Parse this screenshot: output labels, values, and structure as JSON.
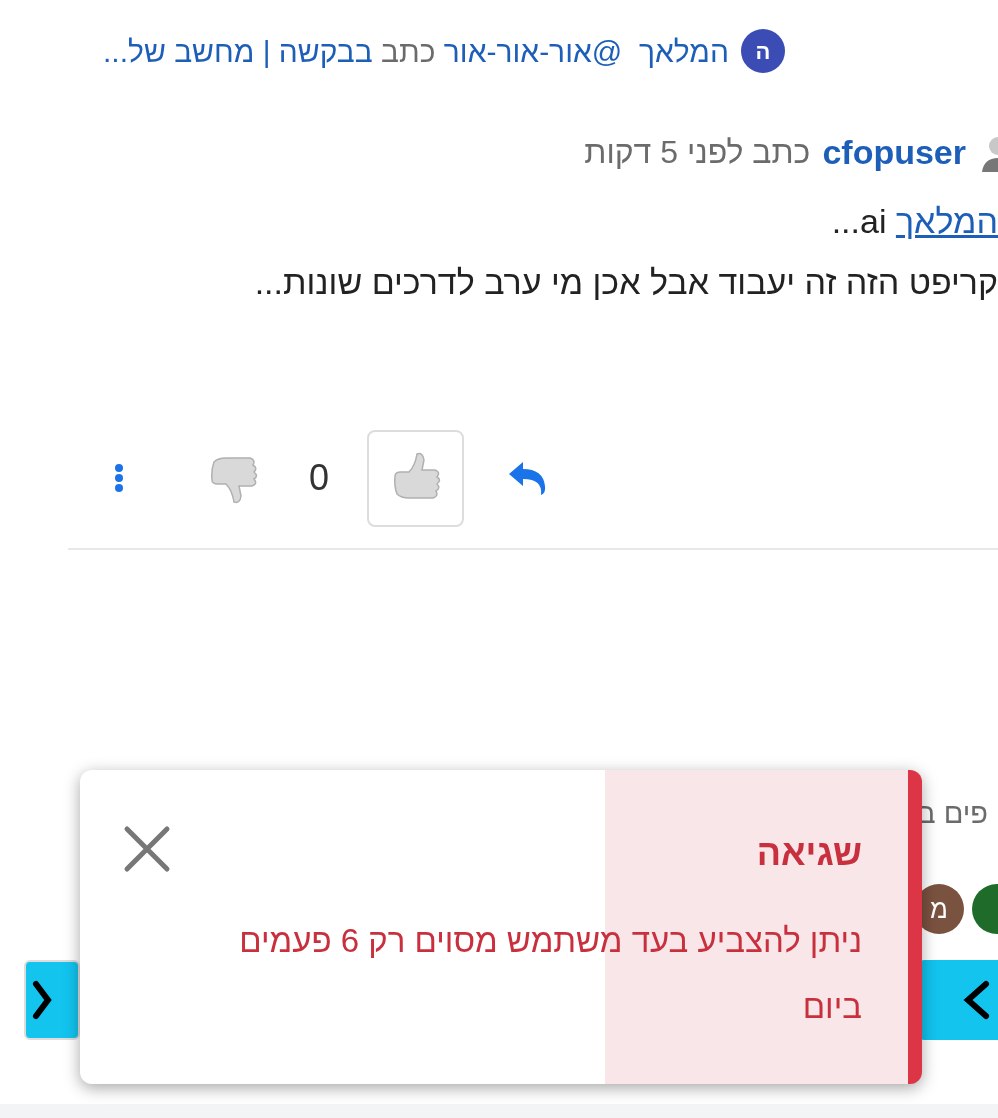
{
  "breadcrumb": {
    "avatar_letter": "ה",
    "parts": [
      {
        "text": "המלאך",
        "kind": "link"
      },
      {
        "text": "@אור-אור-אור",
        "kind": "link"
      },
      {
        "text": "כתב",
        "kind": "plain"
      },
      {
        "text": "בבקשה | מחשב של...",
        "kind": "link"
      }
    ]
  },
  "post": {
    "author": "cfopuser",
    "meta": "כתב לפני 5 דקות",
    "mention": {
      "link": "המלאך",
      "text": "ai..."
    },
    "body": "קריפט הזה זה יעבוד אבל אכן מי ערב לדרכים שונות...",
    "vote_count": "0"
  },
  "background": {
    "text": "פים ב",
    "avatar_letter": "מ"
  },
  "toast": {
    "title": "שגיאה",
    "message": "ניתן להצביע בעד משתמש מסוים רק 6 פעמים ביום"
  }
}
